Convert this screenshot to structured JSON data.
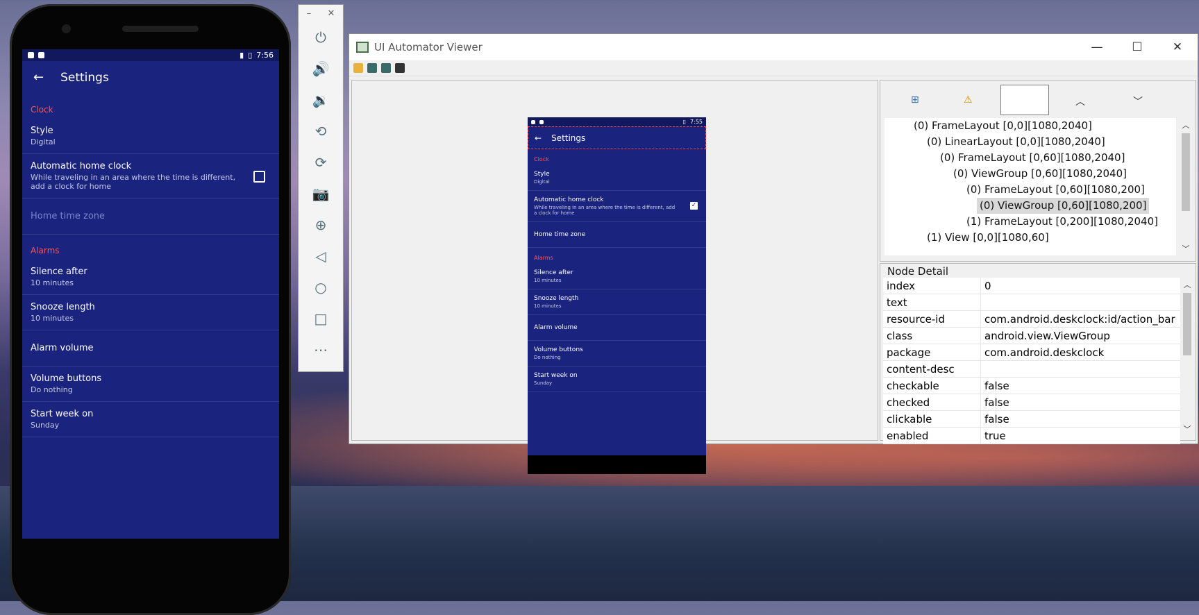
{
  "phone": {
    "status_time": "7:56",
    "appbar_title": "Settings",
    "sections": {
      "clock": "Clock",
      "alarms": "Alarms"
    },
    "rows": [
      {
        "title": "Style",
        "subtitle": "Digital"
      },
      {
        "title": "Automatic home clock",
        "subtitle": "While traveling in an area where the time is different, add a clock for home"
      },
      {
        "title": "Home time zone",
        "subtitle": ""
      },
      {
        "title": "Silence after",
        "subtitle": "10 minutes"
      },
      {
        "title": "Snooze length",
        "subtitle": "10 minutes"
      },
      {
        "title": "Alarm volume",
        "subtitle": ""
      },
      {
        "title": "Volume buttons",
        "subtitle": "Do nothing"
      },
      {
        "title": "Start week on",
        "subtitle": "Sunday"
      }
    ]
  },
  "emulator_toolbar": {
    "minimize": "–",
    "close": "✕",
    "buttons": [
      "power-icon",
      "volume-up-icon",
      "volume-down-icon",
      "rotate-left-icon",
      "rotate-right-icon",
      "camera-icon",
      "zoom-icon",
      "back-icon",
      "home-icon",
      "overview-icon",
      "more-icon"
    ]
  },
  "viewer": {
    "title": "UI Automator Viewer",
    "window_buttons": {
      "minimize": "—",
      "maximize": "☐",
      "close": "✕"
    },
    "screenshot": {
      "status_time": "7:55",
      "appbar_title": "Settings",
      "sections": {
        "clock": "Clock",
        "alarms": "Alarms"
      },
      "rows": [
        {
          "title": "Style",
          "subtitle": "Digital"
        },
        {
          "title": "Automatic home clock",
          "subtitle": "While traveling in an area where the time is different, add a clock for home"
        },
        {
          "title": "Home time zone",
          "subtitle": ""
        },
        {
          "title": "Silence after",
          "subtitle": "10 minutes"
        },
        {
          "title": "Snooze length",
          "subtitle": "10 minutes"
        },
        {
          "title": "Alarm volume",
          "subtitle": ""
        },
        {
          "title": "Volume buttons",
          "subtitle": "Do nothing"
        },
        {
          "title": "Start week on",
          "subtitle": "Sunday"
        }
      ]
    },
    "tree": [
      "(0) FrameLayout [0,0][1080,2040]",
      "(0) LinearLayout [0,0][1080,2040]",
      "(0) FrameLayout [0,60][1080,2040]",
      "(0) ViewGroup [0,60][1080,2040]",
      "(0) FrameLayout [0,60][1080,200]",
      "(0) ViewGroup [0,60][1080,200]",
      "(1) FrameLayout [0,200][1080,2040]",
      "(1) View [0,0][1080,60]"
    ],
    "node_detail": {
      "header": "Node Detail",
      "rows": [
        {
          "key": "index",
          "value": "0"
        },
        {
          "key": "text",
          "value": ""
        },
        {
          "key": "resource-id",
          "value": "com.android.deskclock:id/action_bar"
        },
        {
          "key": "class",
          "value": "android.view.ViewGroup"
        },
        {
          "key": "package",
          "value": "com.android.deskclock"
        },
        {
          "key": "content-desc",
          "value": ""
        },
        {
          "key": "checkable",
          "value": "false"
        },
        {
          "key": "checked",
          "value": "false"
        },
        {
          "key": "clickable",
          "value": "false"
        },
        {
          "key": "enabled",
          "value": "true"
        }
      ]
    }
  }
}
